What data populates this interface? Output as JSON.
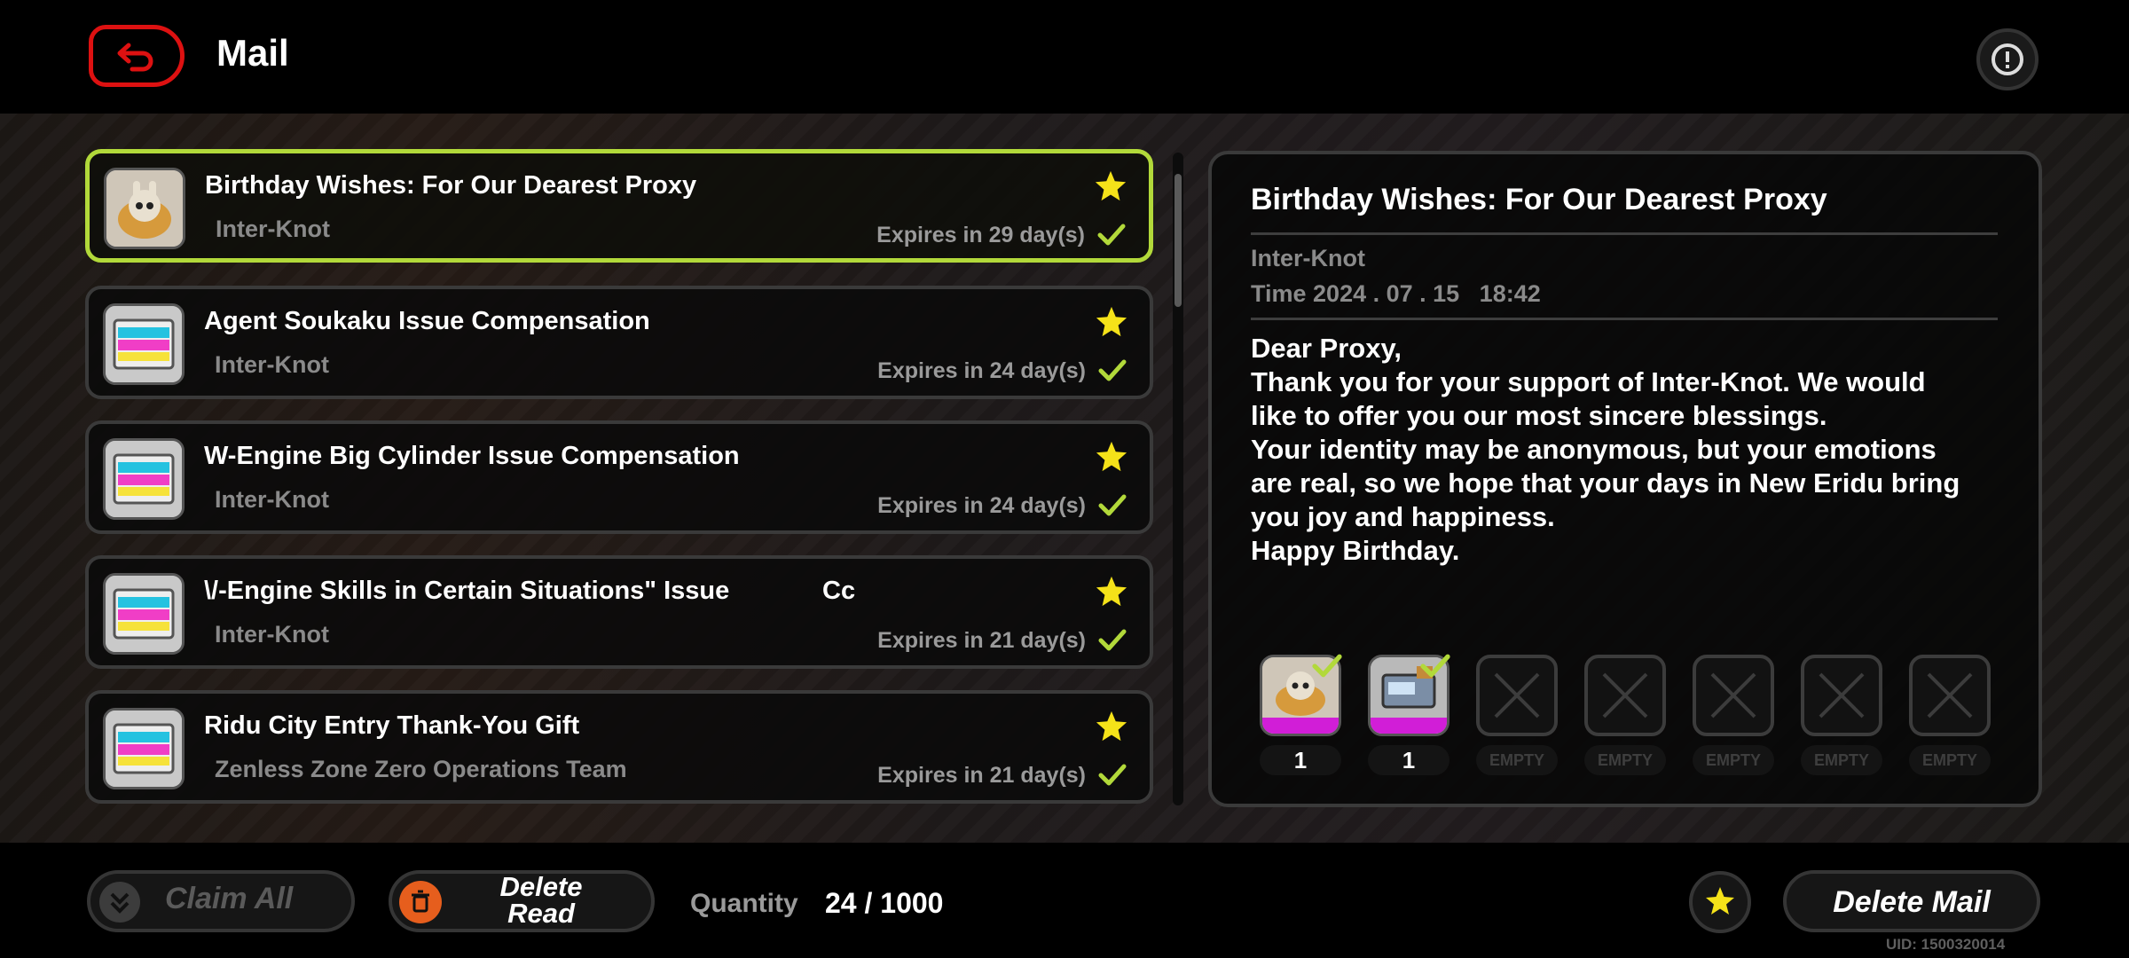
{
  "header": {
    "title": "Mail"
  },
  "mails": [
    {
      "title": "Birthday Wishes: For Our Dearest Proxy",
      "sender": "Inter-Knot",
      "expires": "Expires in 29 day(s)",
      "icon": "bangboo-cake-icon",
      "selected": true
    },
    {
      "title": "Agent Soukaku Issue Compensation",
      "sender": "Inter-Knot",
      "expires": "Expires in 24 day(s)",
      "icon": "film-reel-icon"
    },
    {
      "title": "W-Engine Big Cylinder Issue Compensation",
      "sender": "Inter-Knot",
      "expires": "Expires in 24 day(s)",
      "icon": "film-reel-icon"
    },
    {
      "title": "\\/-Engine Skills in Certain Situations\" Issue             Cc",
      "sender": "Inter-Knot",
      "expires": "Expires in 21 day(s)",
      "icon": "film-reel-icon"
    },
    {
      "title": "Ridu City Entry Thank-You Gift",
      "sender": "Zenless Zone Zero Operations Team",
      "expires": "Expires in 21 day(s)",
      "icon": "film-reel-icon"
    }
  ],
  "detail": {
    "title": "Birthday Wishes: For Our Dearest Proxy",
    "sender": "Inter-Knot",
    "time": "Time 2024 . 07 . 15   18:42",
    "body": "Dear Proxy,\nThank you for your support of Inter-Knot. We would like to offer you our most sincere blessings.\nYour identity may be anonymous, but your emotions are real, so we hope that your days in New Eridu bring you joy and happiness.\nHappy Birthday.",
    "attachments": [
      {
        "label": "1",
        "icon": "bangboo-cake-icon",
        "claimed": true
      },
      {
        "label": "1",
        "icon": "toolbox-icon",
        "claimed": true
      },
      {
        "label": "EMPTY",
        "icon": "empty-slot-icon"
      },
      {
        "label": "EMPTY",
        "icon": "empty-slot-icon"
      },
      {
        "label": "EMPTY",
        "icon": "empty-slot-icon"
      },
      {
        "label": "EMPTY",
        "icon": "empty-slot-icon"
      },
      {
        "label": "EMPTY",
        "icon": "empty-slot-icon"
      }
    ]
  },
  "footer": {
    "claim_all": "Claim All",
    "delete_read": "Delete\nRead",
    "quantity_label": "Quantity",
    "quantity_value": "24 / 1000",
    "delete_mail": "Delete Mail",
    "uid": "UID: 1500320014"
  },
  "colors": {
    "selected_border": "#b2d93a",
    "star": "#f5e219",
    "check": "#b2d93a",
    "accent_red": "#d11111",
    "attachment_bar": "#d11ed7",
    "delete_icon": "#e65e1d"
  }
}
